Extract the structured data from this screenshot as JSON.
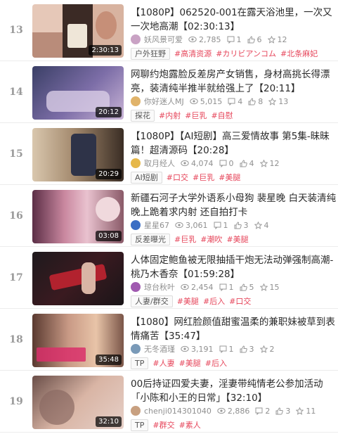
{
  "accent_color": "#e6455a",
  "items": [
    {
      "rank": "13",
      "title": "【1080P】062520-001在露天浴池里，一次又一次地高潮【02:30:13】",
      "duration": "2:30:13",
      "author": "妖风景可爱",
      "views": "2,785",
      "comments": "1",
      "likes": "6",
      "favorites": "12",
      "category": "户外狂野",
      "tags": [
        "#高清资源",
        "#カリビアンコム",
        "#北条麻妃"
      ],
      "thumb_colors": [
        "#3a2a22",
        "#d9b8a8"
      ],
      "avatar_color": "#c9a2c4"
    },
    {
      "rank": "14",
      "title": "网聊约炮露脸反差房产女销售，身材高挑长得漂亮，装清纯半推半就给强上了【20:11】",
      "duration": "20:12",
      "author": "你好迷人MJ",
      "views": "5,015",
      "comments": "4",
      "likes": "8",
      "favorites": "13",
      "category": "探花",
      "tags": [
        "#内射",
        "#巨乳",
        "#自慰"
      ],
      "thumb_colors": [
        "#2e3652",
        "#8d7fb0"
      ],
      "avatar_color": "#e0b36a"
    },
    {
      "rank": "15",
      "title": "【1080P】【AI短剧】高三爱情故事 第5集-昧昧篇！超清源码【20:28】",
      "duration": "20:29",
      "author": "取月经人",
      "views": "4,074",
      "comments": "0",
      "likes": "4",
      "favorites": "12",
      "category": "AI短剧",
      "tags": [
        "#口交",
        "#巨乳",
        "#美腿"
      ],
      "thumb_colors": [
        "#4a3a2c",
        "#c8b49a"
      ],
      "avatar_color": "#e6b84a"
    },
    {
      "rank": "16",
      "title": "新疆石河子大学外语系小母狗 裴星晚 白天装清纯晚上跪着求内射 还自拍打卡",
      "duration": "03:08",
      "author": "星星67",
      "views": "3,061",
      "comments": "1",
      "likes": "3",
      "favorites": "4",
      "category": "反差曝光",
      "tags": [
        "#巨乳",
        "#潮吹",
        "#美腿"
      ],
      "thumb_colors": [
        "#5b2e46",
        "#e3a3c0"
      ],
      "avatar_color": "#3b6ec4"
    },
    {
      "rank": "17",
      "title": "人体固定鲍鱼被无限抽插干炮无法动弹强制高潮-桃乃木香奈【01:59:28】",
      "duration": "",
      "author": "琼台秋叶",
      "views": "2,454",
      "comments": "1",
      "likes": "5",
      "favorites": "15",
      "category": "人妻/群交",
      "tags": [
        "#美腿",
        "#后入",
        "#口交"
      ],
      "thumb_colors": [
        "#1e1a1d",
        "#b2222e"
      ],
      "avatar_color": "#a05ab0"
    },
    {
      "rank": "18",
      "title": "【1080】网红脸颜值甜蜜温柔的兼职妹被草到表情痛苦【35:47】",
      "duration": "35:48",
      "author": "无冬酒瑾",
      "views": "3,191",
      "comments": "1",
      "likes": "3",
      "favorites": "2",
      "category": "TP",
      "tags": [
        "#人妻",
        "#美腿",
        "#后入"
      ],
      "thumb_colors": [
        "#5a3a30",
        "#e8c4a8"
      ],
      "avatar_color": "#7a9ab8"
    },
    {
      "rank": "19",
      "title": "00后持证四爱夫妻，淫妻带纯情老公参加活动「小陈和小王的日常」【32:10】",
      "duration": "32:10",
      "author": "chenji014301040",
      "views": "2,886",
      "comments": "2",
      "likes": "3",
      "favorites": "11",
      "category": "TP",
      "tags": [
        "#群交",
        "#素人"
      ],
      "thumb_colors": [
        "#6a4e48",
        "#d9b5a5"
      ],
      "avatar_color": "#c8a080"
    }
  ]
}
